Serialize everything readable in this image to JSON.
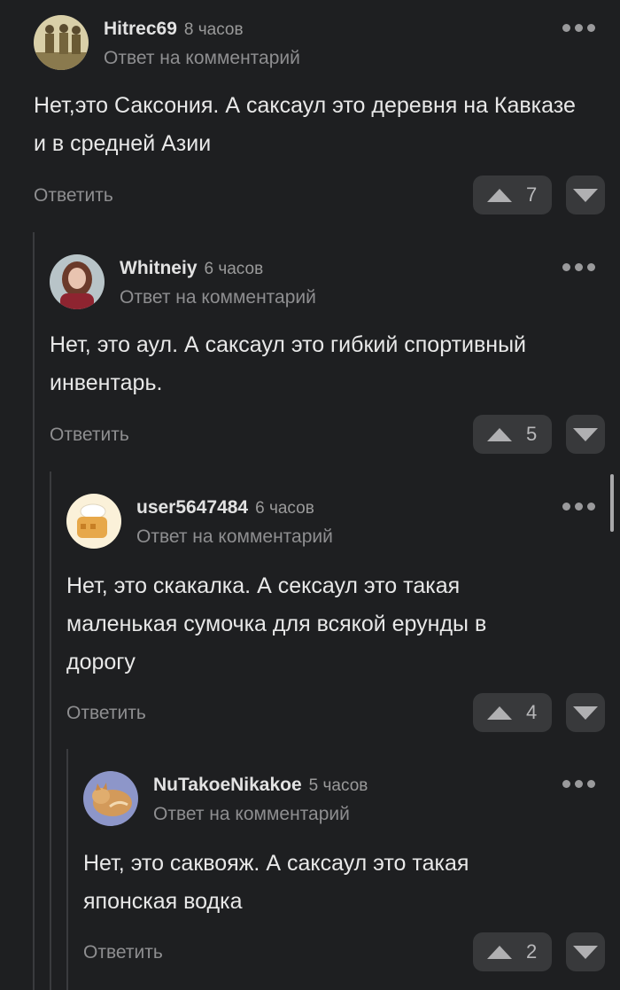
{
  "comments": [
    {
      "author": "Hitrec69",
      "time": "8 часов",
      "reply_to": "Ответ на комментарий",
      "text": "Нет,это Саксония. А саксаул это деревня на Кавказе и в средней Азии",
      "reply_label": "Ответить",
      "votes": "7",
      "avatar_icon": "soldiers-photo-avatar"
    },
    {
      "author": "Whitneiy",
      "time": "6 часов",
      "reply_to": "Ответ на комментарий",
      "text": "Нет, это аул. А саксаул это гибкий спортивный инвентарь.",
      "reply_label": "Ответить",
      "votes": "5",
      "avatar_icon": "girl-photo-avatar"
    },
    {
      "author": "user5647484",
      "time": "6 часов",
      "reply_to": "Ответ на комментарий",
      "text": "Нет, это скакалка. А сексаул это такая маленькая сумочка для всякой ерунды в дорогу",
      "reply_label": "Ответить",
      "votes": "4",
      "avatar_icon": "bread-cartoon-avatar"
    },
    {
      "author": "NuTakoeNikakoe",
      "time": "5 часов",
      "reply_to": "Ответ на комментарий",
      "text": "Нет, это саквояж. А саксаул это такая японская водка",
      "reply_label": "Ответить",
      "votes": "2",
      "avatar_icon": "cat-photo-avatar"
    }
  ],
  "colors": {
    "background": "#1e1f21",
    "text": "#e8e8e8",
    "muted": "#8e8e90",
    "button_bg": "#38393b",
    "thread_line": "#3a3b3e"
  }
}
